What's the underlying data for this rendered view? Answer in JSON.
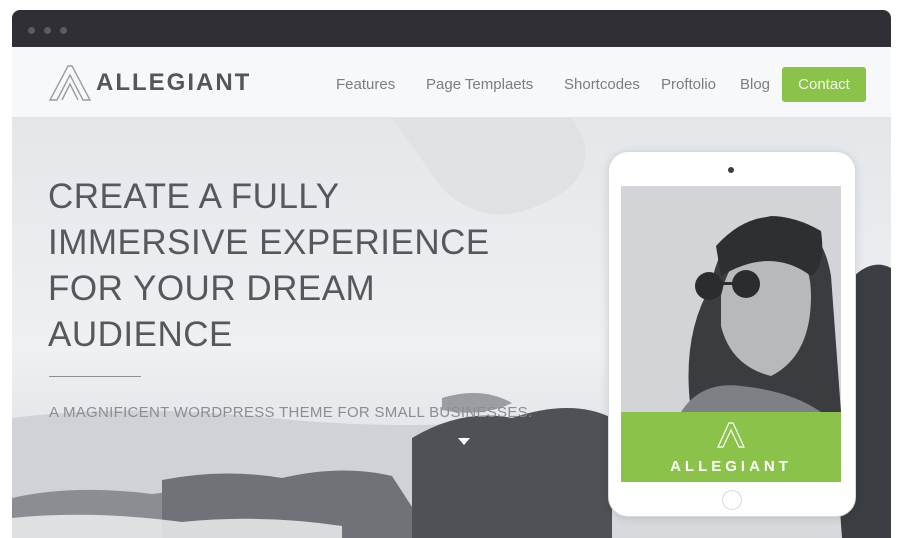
{
  "window": {
    "controls": [
      "close",
      "minimize",
      "maximize"
    ]
  },
  "header": {
    "logo_text": "ALLEGIANT",
    "logo_icon": "allegiant-a-mark-icon",
    "nav": [
      {
        "label": "Features"
      },
      {
        "label": "Page Templaets"
      },
      {
        "label": "Shortcodes"
      },
      {
        "label": "Proftolio"
      },
      {
        "label": "Blog"
      }
    ],
    "contact_label": "Contact"
  },
  "hero": {
    "headline": "CREATE A FULLY IMMERSIVE EXPERIENCE FOR YOUR DREAM AUDIENCE",
    "headline_lines": [
      "CREATE A FULLY",
      "IMMERSIVE EXPERIENCE",
      "FOR YOUR DREAM",
      "AUDIENCE"
    ],
    "subtitle": "A MAGNIFICENT WORDPRESS THEME FOR SMALL BUSINESSES.",
    "scroll_icon": "chevron-down-icon"
  },
  "tablet": {
    "brand_text": "ALLEGIANT",
    "brand_icon": "allegiant-a-mark-icon"
  },
  "colors": {
    "accent": "#8bc34a",
    "chrome": "#2f2f35",
    "text_dark": "#55585d",
    "text_muted": "#7a7d82"
  }
}
